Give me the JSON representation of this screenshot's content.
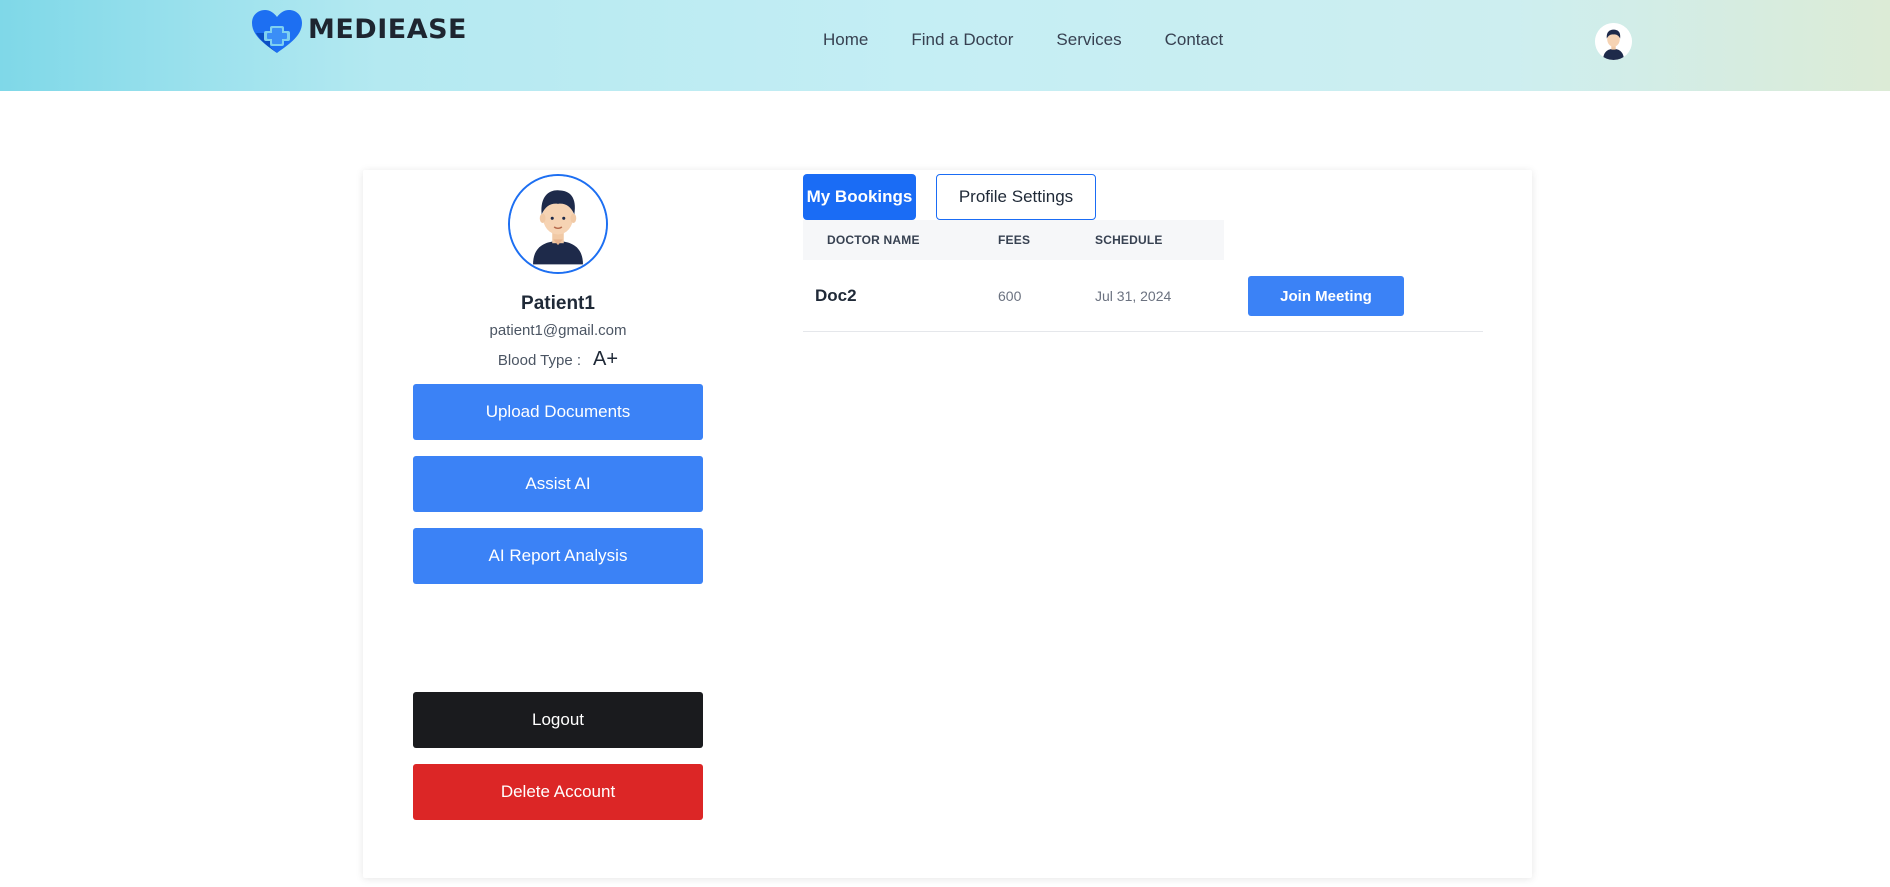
{
  "brand": {
    "name": "MEDIEASE",
    "icon": "heart-plus-logo-icon"
  },
  "nav": {
    "items": [
      "Home",
      "Find a Doctor",
      "Services",
      "Contact"
    ]
  },
  "header": {
    "avatar_icon": "user-avatar-icon"
  },
  "profile": {
    "name": "Patient1",
    "email": "patient1@gmail.com",
    "blood_label": "Blood Type :",
    "blood_value": "A+"
  },
  "actions": {
    "upload": "Upload Documents",
    "assist": "Assist AI",
    "report": "AI Report Analysis",
    "logout": "Logout",
    "delete": "Delete Account"
  },
  "tabs": {
    "active": "My Bookings",
    "inactive": "Profile Settings"
  },
  "table": {
    "headers": [
      "DOCTOR NAME",
      "FEES",
      "SCHEDULE"
    ],
    "rows": [
      {
        "doctor": "Doc2",
        "fees": "600",
        "schedule": "Jul 31, 2024",
        "action": "Join Meeting"
      }
    ]
  },
  "colors": {
    "primary": "#1a6cf5",
    "button_blue": "#3b82f6",
    "logout": "#1a1b1e",
    "danger": "#dc2626"
  }
}
